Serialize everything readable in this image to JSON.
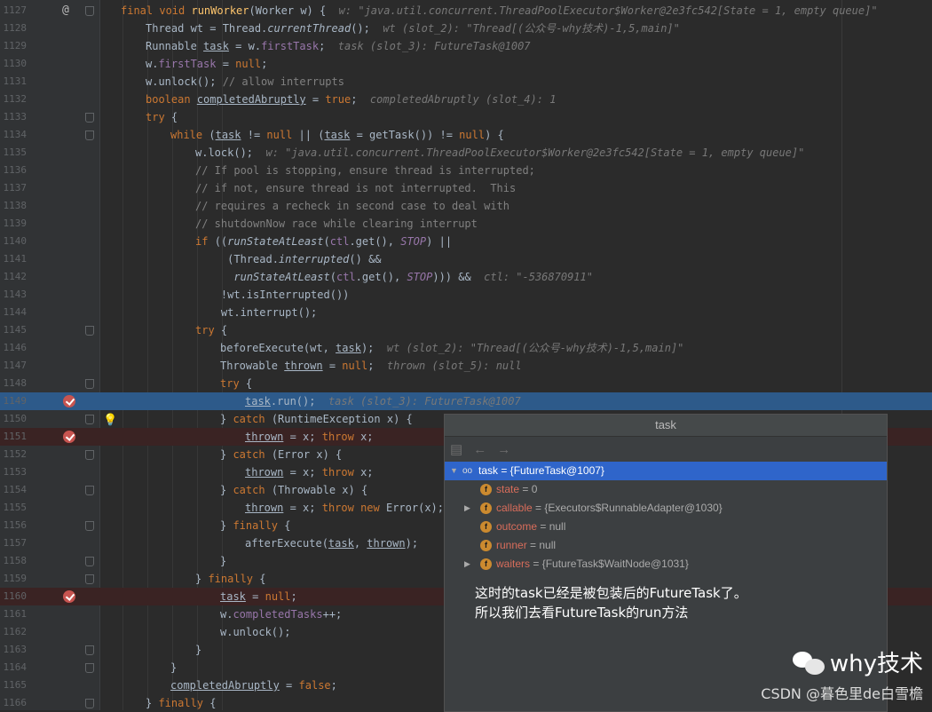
{
  "colors": {
    "keyword": "#cc7832",
    "function": "#ffc66d",
    "comment": "#808080",
    "string": "#6a8759",
    "number": "#6897bb",
    "field": "#9876aa",
    "selection": "#2d5a8a",
    "breakpoint": "#c75450"
  },
  "lines": [
    {
      "n": "1127",
      "indent": 0,
      "html": "<span class='kw'>final void </span><span class='fn'>runWorker</span>(Worker w) {  <span class='hint'>w: \"java.util.concurrent.ThreadPoolExecutor$Worker@2e3fc542[State = 1, empty queue]\"</span>"
    },
    {
      "n": "1128",
      "indent": 1,
      "html": "Thread wt = Thread.<i>currentThread</i>();  <span class='hint'>wt (slot_2): \"Thread[(公众号-why技术)-1,5,main]\"</span>"
    },
    {
      "n": "1129",
      "indent": 1,
      "html": "Runnable <u>task</u> = w.<span class='fld'>firstTask</span>;  <span class='hint'>task (slot_3): FutureTask@1007</span>"
    },
    {
      "n": "1130",
      "indent": 1,
      "html": "w.<span class='fld'>firstTask</span> = <span class='kw'>null</span>;"
    },
    {
      "n": "1131",
      "indent": 1,
      "html": "w.unlock(); <span class='cmt'>// allow interrupts</span>"
    },
    {
      "n": "1132",
      "indent": 1,
      "html": "<span class='kw'>boolean </span><u>completedAbruptly</u> = <span class='kw'>true</span>;  <span class='hint'>completedAbruptly (slot_4): 1</span>"
    },
    {
      "n": "1133",
      "indent": 1,
      "html": "<span class='kw'>try </span>{"
    },
    {
      "n": "1134",
      "indent": 2,
      "html": "<span class='kw'>while </span>(<u>task</u> != <span class='kw'>null </span>|| (<u>task</u> = getTask()) != <span class='kw'>null</span>) {"
    },
    {
      "n": "1135",
      "indent": 3,
      "html": "w.lock();  <span class='hint'>w: \"java.util.concurrent.ThreadPoolExecutor$Worker@2e3fc542[State = 1, empty queue]\"</span>"
    },
    {
      "n": "1136",
      "indent": 3,
      "html": "<span class='cmt'>// If pool is stopping, ensure thread is interrupted;</span>"
    },
    {
      "n": "1137",
      "indent": 3,
      "html": "<span class='cmt'>// if not, ensure thread is not interrupted.  This</span>"
    },
    {
      "n": "1138",
      "indent": 3,
      "html": "<span class='cmt'>// requires a recheck in second case to deal with</span>"
    },
    {
      "n": "1139",
      "indent": 3,
      "html": "<span class='cmt'>// shutdownNow race while clearing interrupt</span>"
    },
    {
      "n": "1140",
      "indent": 3,
      "html": "<span class='kw'>if </span>((<i>runStateAtLeast</i>(<span class='fld'>ctl</span>.get(), <i class='fld'>STOP</i>) ||"
    },
    {
      "n": "1141",
      "indent": 3,
      "html": "     (Thread.<i>interrupted</i>() &amp;&amp;"
    },
    {
      "n": "1142",
      "indent": 3,
      "html": "      <i>runStateAtLeast</i>(<span class='fld'>ctl</span>.get(), <i class='fld'>STOP</i>))) &amp;&amp;  <span class='hint'>ctl: \"-536870911\"</span>"
    },
    {
      "n": "1143",
      "indent": 3,
      "html": "    !wt.isInterrupted())"
    },
    {
      "n": "1144",
      "indent": 3,
      "html": "    wt.interrupt();"
    },
    {
      "n": "1145",
      "indent": 3,
      "html": "<span class='kw'>try </span>{"
    },
    {
      "n": "1146",
      "indent": 4,
      "html": "beforeExecute(wt, <u>task</u>);  <span class='hint'>wt (slot_2): \"Thread[(公众号-why技术)-1,5,main]\"</span>"
    },
    {
      "n": "1147",
      "indent": 4,
      "html": "Throwable <u>thrown</u> = <span class='kw'>null</span>;  <span class='hint'>thrown (slot_5): null</span>"
    },
    {
      "n": "1148",
      "indent": 4,
      "html": "<span class='kw'>try </span>{"
    },
    {
      "n": "1149",
      "indent": 5,
      "html": "<u>task</u>.run();  <span class='hint'>task (slot_3): FutureTask@1007</span>"
    },
    {
      "n": "1150",
      "indent": 4,
      "html": "} <span class='kw'>catch </span>(RuntimeException x) {"
    },
    {
      "n": "1151",
      "indent": 5,
      "html": "<u>thrown</u> = x; <span class='kw'>throw </span>x;"
    },
    {
      "n": "1152",
      "indent": 4,
      "html": "} <span class='kw'>catch </span>(Error x) {"
    },
    {
      "n": "1153",
      "indent": 5,
      "html": "<u>thrown</u> = x; <span class='kw'>throw </span>x;"
    },
    {
      "n": "1154",
      "indent": 4,
      "html": "} <span class='kw'>catch </span>(Throwable x) {"
    },
    {
      "n": "1155",
      "indent": 5,
      "html": "<u>thrown</u> = x; <span class='kw'>throw new </span>Error(x);"
    },
    {
      "n": "1156",
      "indent": 4,
      "html": "} <span class='kw'>finally </span>{"
    },
    {
      "n": "1157",
      "indent": 5,
      "html": "afterExecute(<u>task</u>, <u>thrown</u>);"
    },
    {
      "n": "1158",
      "indent": 4,
      "html": "}"
    },
    {
      "n": "1159",
      "indent": 3,
      "html": "} <span class='kw'>finally </span>{"
    },
    {
      "n": "1160",
      "indent": 4,
      "html": "<u>task</u> = <span class='kw'>null</span>;"
    },
    {
      "n": "1161",
      "indent": 4,
      "html": "w.<span class='fld'>completedTasks</span>++;"
    },
    {
      "n": "1162",
      "indent": 4,
      "html": "w.unlock();"
    },
    {
      "n": "1163",
      "indent": 3,
      "html": "}"
    },
    {
      "n": "1164",
      "indent": 2,
      "html": "}"
    },
    {
      "n": "1165",
      "indent": 2,
      "html": "<u>completedAbruptly</u> = <span class='kw'>false</span>;"
    },
    {
      "n": "1166",
      "indent": 1,
      "html": "} <span class='kw'>finally </span>{"
    }
  ],
  "breakpoint_lines": [
    "1149",
    "1151",
    "1160"
  ],
  "current_line": "1149",
  "popup": {
    "title": "task",
    "root": {
      "label": "task = {FutureTask@1007}"
    },
    "fields": [
      {
        "name": "state",
        "value": "= 0",
        "expandable": false
      },
      {
        "name": "callable",
        "value": "= {Executors$RunnableAdapter@1030}",
        "expandable": true
      },
      {
        "name": "outcome",
        "value": "= null",
        "expandable": false
      },
      {
        "name": "runner",
        "value": "= null",
        "expandable": false
      },
      {
        "name": "waiters",
        "value": "= {FutureTask$WaitNode@1031}",
        "expandable": true
      }
    ],
    "note_line1": "这时的task已经是被包装后的FutureTask了。",
    "note_line2": "所以我们去看FutureTask的run方法"
  },
  "watermark": {
    "brand": "why技术",
    "credit": "CSDN @暮色里de白雪檐"
  }
}
